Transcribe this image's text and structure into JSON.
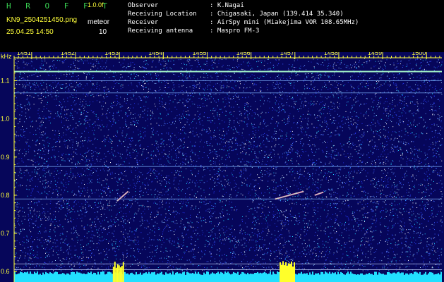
{
  "header": {
    "brand": "H R O F F T",
    "version": "1.0.0f",
    "filename": "KN9_2504251450.png",
    "timestamp": "25.04.25 14:50",
    "unit": "meteor",
    "count": "10",
    "info": [
      {
        "label": "Observer",
        "value": ": K.Nagai"
      },
      {
        "label": "Receiving Location",
        "value": ": Chigasaki, Japan (139.414 35.340)"
      },
      {
        "label": "Receiver",
        "value": ": AirSpy mini (Miakejima VOR 108.65MHz)"
      },
      {
        "label": "Receiving antenna",
        "value": ": Maspro FM-3"
      }
    ]
  },
  "colors": {
    "header_text": "#ffffff",
    "brand_text": "#39d353",
    "version_text": "#ffff3a",
    "filename_text": "#ffff3a",
    "axis": "#ffff3a",
    "background": "#06065a",
    "baseline": "#22e0ff",
    "peak": "#ffff2a"
  },
  "chart_data": {
    "type": "heatmap",
    "title": "",
    "xlabel": "",
    "ylabel": "kHz",
    "x_ticks": [
      "1451",
      "1452",
      "1453",
      "1454",
      "1455",
      "1456",
      "1457",
      "1458",
      "1459",
      "1500"
    ],
    "y_ticks": [
      "1.1",
      "1.0",
      "0.9",
      "0.8",
      "0.7",
      "0.6"
    ],
    "ylim": [
      0.58,
      1.16
    ],
    "horizontal_lines_khz": [
      1.124,
      1.1,
      1.068,
      0.875,
      0.79,
      0.62,
      0.605
    ],
    "meteor_traces": [
      {
        "t_start": 1452.95,
        "t_end": 1453.2,
        "f_start": 0.785,
        "f_end": 0.81
      },
      {
        "t_start": 1456.55,
        "t_end": 1457.2,
        "f_start": 0.79,
        "f_end": 0.81
      },
      {
        "t_start": 1457.45,
        "t_end": 1457.65,
        "f_start": 0.8,
        "f_end": 0.808
      }
    ],
    "bottom_bar_peaks": [
      {
        "t_start": 1452.85,
        "t_end": 1453.1
      },
      {
        "t_start": 1456.65,
        "t_end": 1457.0
      }
    ]
  }
}
